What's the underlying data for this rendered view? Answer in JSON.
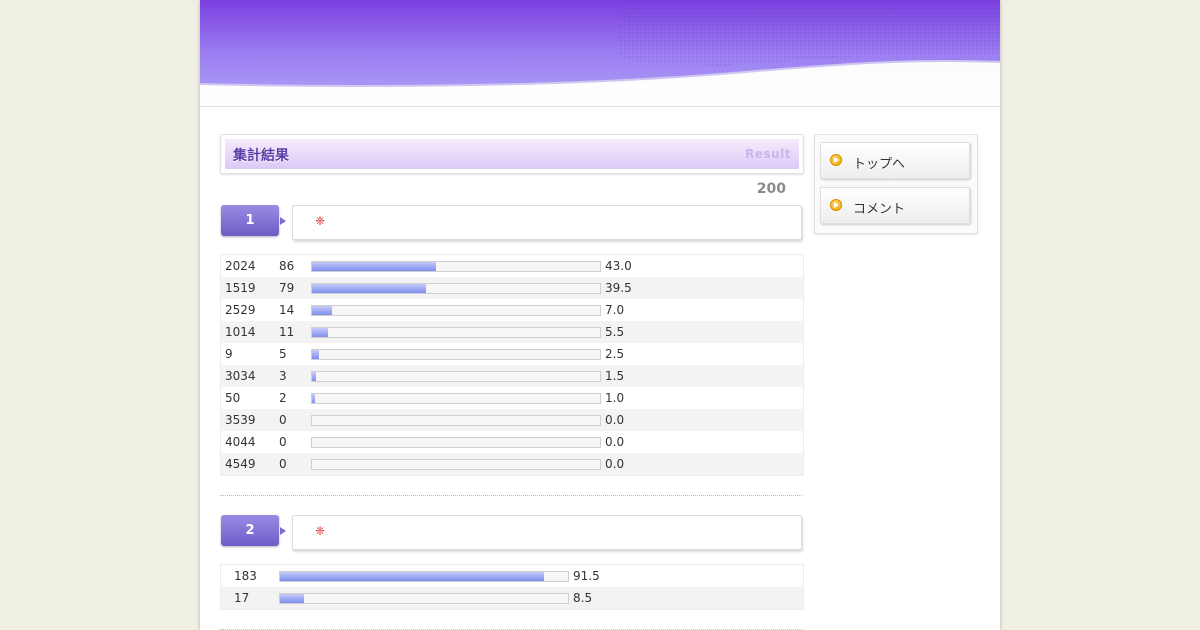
{
  "result_title": "集計結果",
  "result_subtitle": "Result",
  "total": "200",
  "colors": {
    "accent": "#6f5cc7",
    "bar": "#7f8ff0",
    "header": "#8a5cf0"
  },
  "nav": [
    {
      "label": "トップへ",
      "icon": "play-circle-icon"
    },
    {
      "label": "コメント",
      "icon": "play-circle-icon"
    }
  ],
  "questions": [
    {
      "number": "1",
      "mark": "❈",
      "rows": [
        {
          "label": "2024",
          "count": "86",
          "percent": "43.0",
          "value": 43.0
        },
        {
          "label": "1519",
          "count": "79",
          "percent": "39.5",
          "value": 39.5
        },
        {
          "label": "2529",
          "count": "14",
          "percent": "7.0",
          "value": 7.0
        },
        {
          "label": "1014",
          "count": "11",
          "percent": "5.5",
          "value": 5.5
        },
        {
          "label": "9",
          "count": "5",
          "percent": "2.5",
          "value": 2.5
        },
        {
          "label": "3034",
          "count": "3",
          "percent": "1.5",
          "value": 1.5
        },
        {
          "label": "50",
          "count": "2",
          "percent": "1.0",
          "value": 1.0
        },
        {
          "label": "3539",
          "count": "0",
          "percent": "0.0",
          "value": 0.0
        },
        {
          "label": "4044",
          "count": "0",
          "percent": "0.0",
          "value": 0.0
        },
        {
          "label": "4549",
          "count": "0",
          "percent": "0.0",
          "value": 0.0
        }
      ]
    },
    {
      "number": "2",
      "mark": "❈",
      "rows": [
        {
          "count": "183",
          "percent": "91.5",
          "value": 91.5
        },
        {
          "count": "17",
          "percent": "8.5",
          "value": 8.5
        }
      ]
    }
  ]
}
